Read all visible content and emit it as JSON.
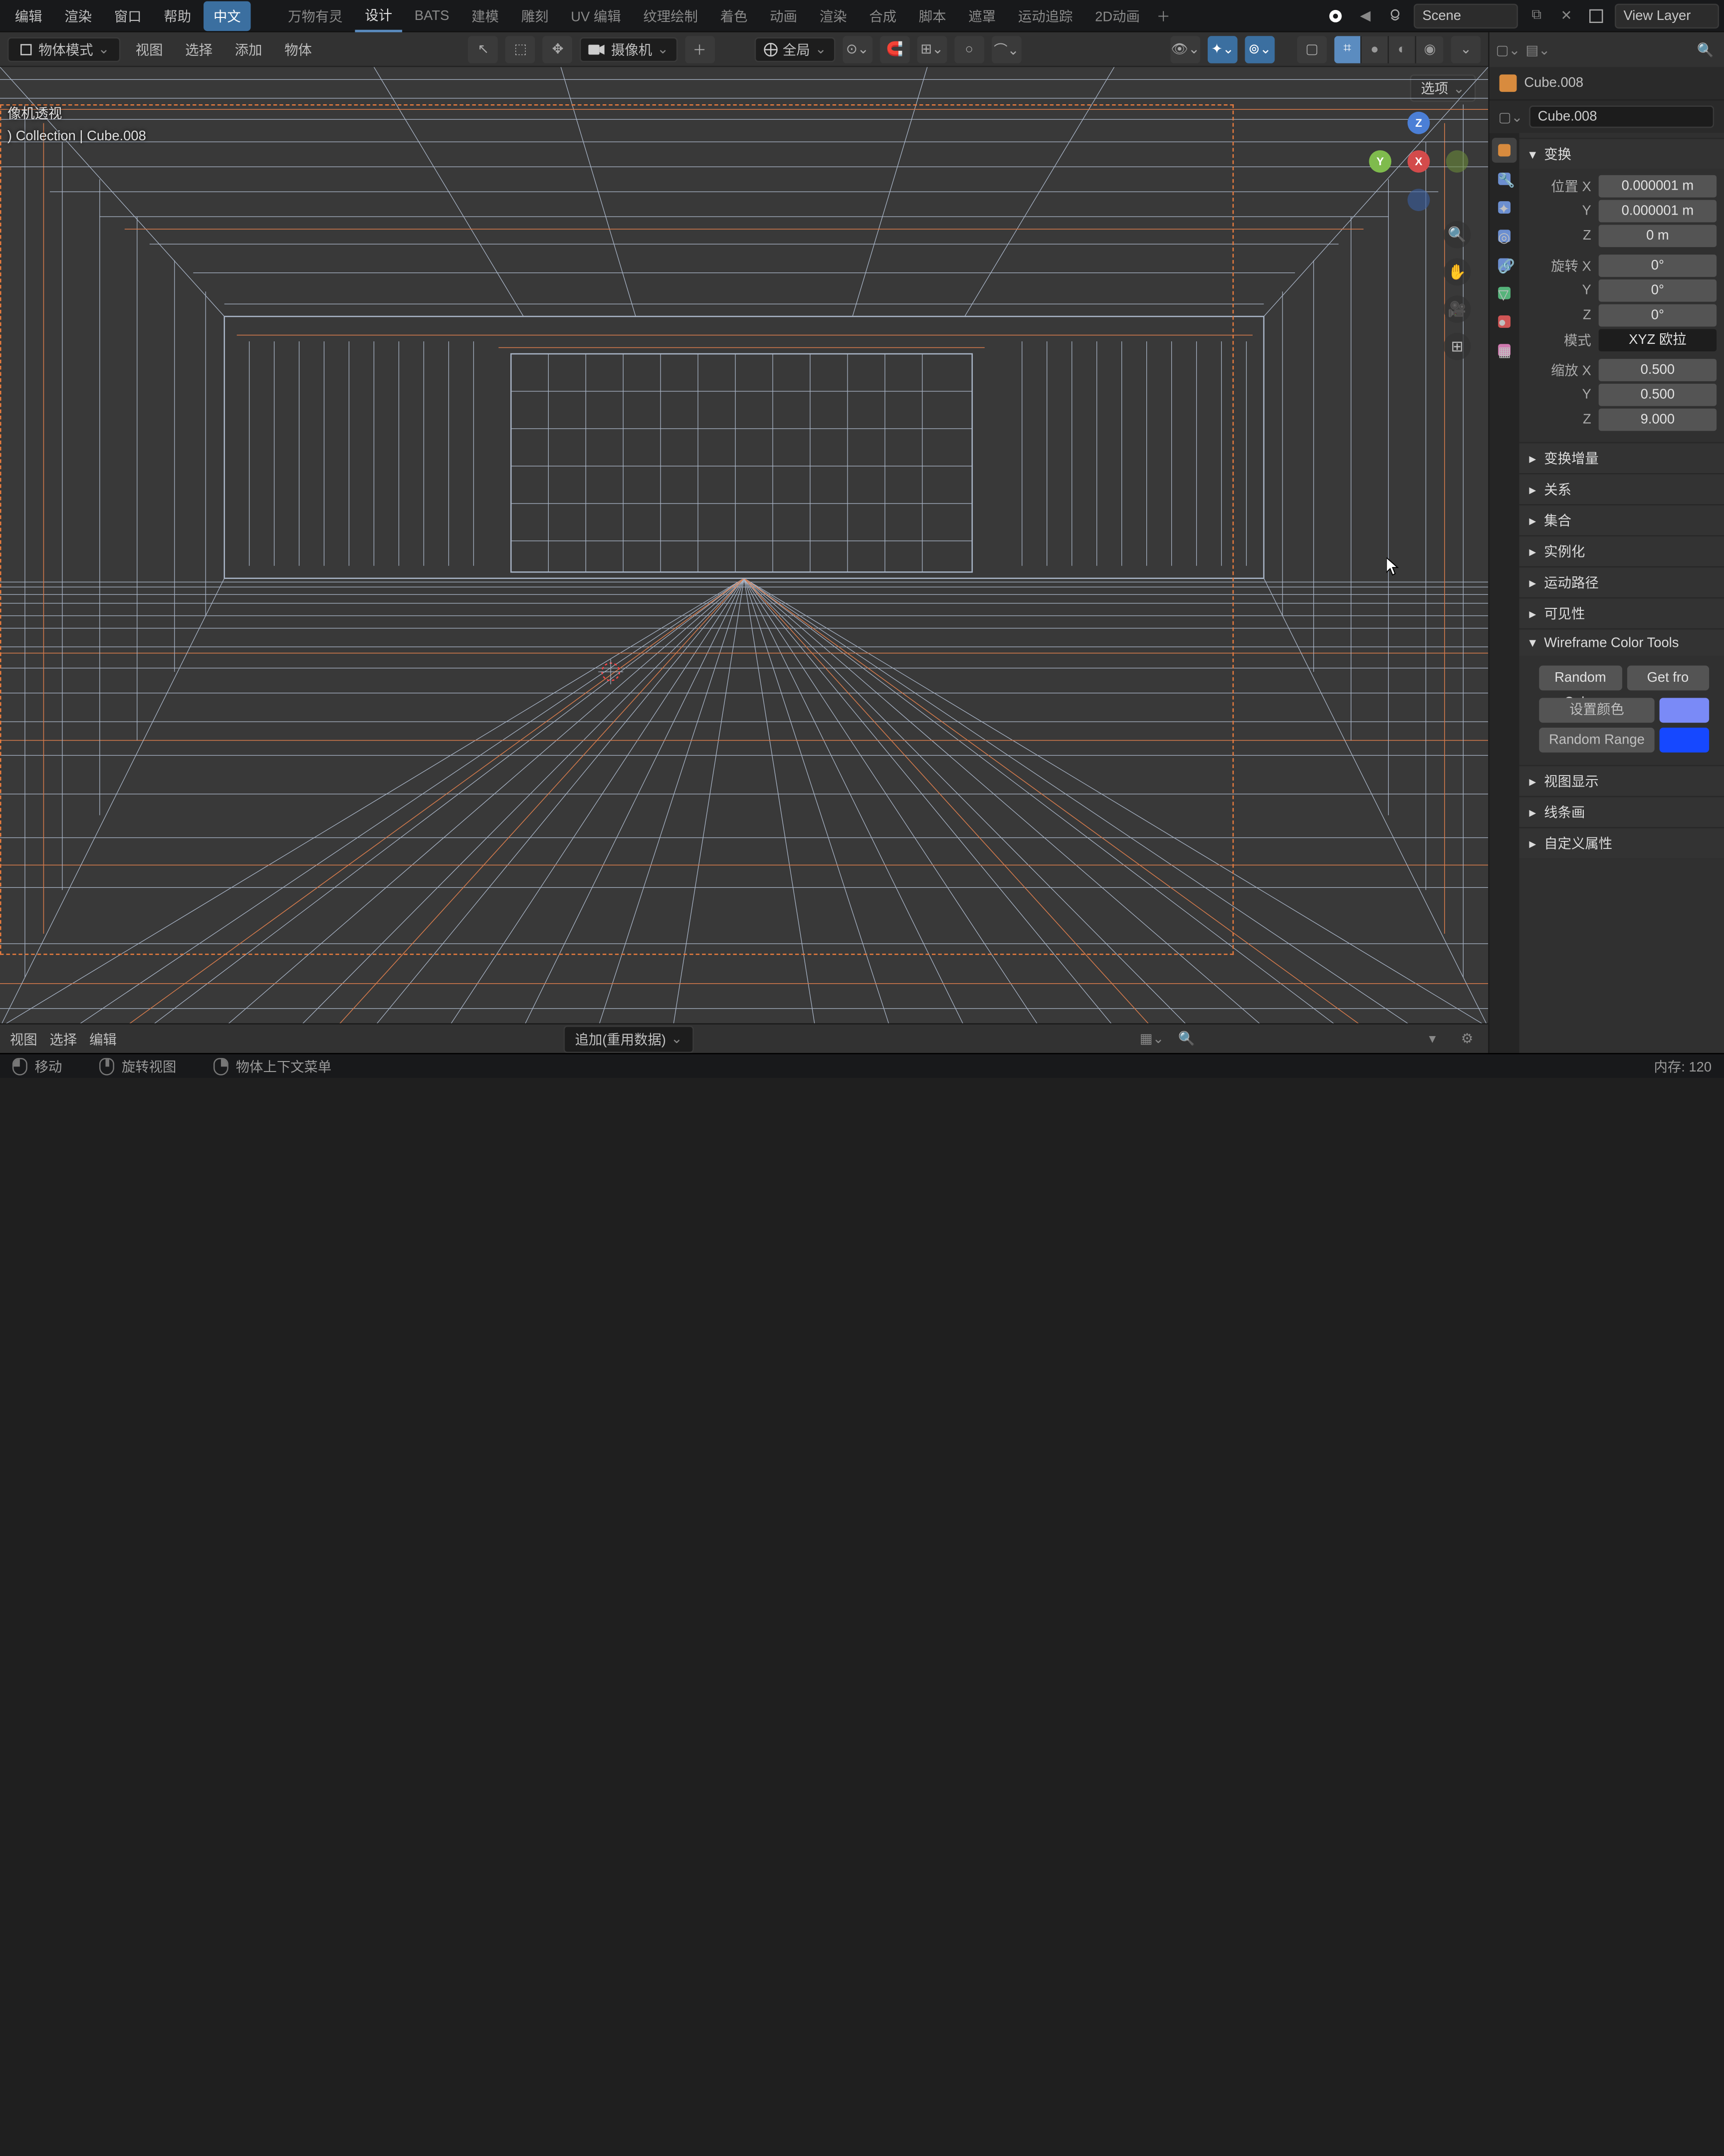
{
  "top_menu": {
    "items": [
      "编辑",
      "渲染",
      "窗口",
      "帮助"
    ],
    "lang": "中文",
    "workspaces": [
      "万物有灵",
      "设计",
      "BATS",
      "建模",
      "雕刻",
      "UV 编辑",
      "纹理绘制",
      "着色",
      "动画",
      "渲染",
      "合成",
      "脚本",
      "遮罩",
      "运动追踪",
      "2D动画"
    ],
    "active_ws": "设计",
    "scene_label": "Scene",
    "view_layer_label": "View Layer"
  },
  "view_toolbar": {
    "mode": "物体模式",
    "menus": [
      "视图",
      "选择",
      "添加",
      "物体"
    ],
    "camera_label": "摄像机",
    "pivot_label": "全局",
    "options_chip": "选项"
  },
  "viewport_overlay": {
    "line1": "像机透视",
    "line2": ") Collection | Cube.008"
  },
  "outliner": {
    "object": "Cube.008",
    "data": "Cube.008"
  },
  "transform": {
    "title": "变换",
    "location": {
      "label": "位置",
      "x": "0.000001 m",
      "y": "0.000001 m",
      "z": "0 m"
    },
    "rotation": {
      "label": "旋转",
      "x": "0°",
      "y": "0°",
      "z": "0°"
    },
    "mode_label": "模式",
    "mode_value": "XYZ 欧拉",
    "scale": {
      "label": "缩放",
      "x": "0.500",
      "y": "0.500",
      "z": "9.000"
    }
  },
  "panels": {
    "delta": "变换增量",
    "relations": "关系",
    "collection": "集合",
    "instancing": "实例化",
    "motion_path": "运动路径",
    "visibility": "可见性",
    "wireframe_tools": "Wireframe Color Tools",
    "viewport_display": "视图显示",
    "lineart": "线条画",
    "custom_props": "自定义属性"
  },
  "wireframe_tools": {
    "random_color": "Random Color",
    "get_from": "Get fro",
    "set_color": "设置颜色",
    "random_range": "Random Range",
    "swatch1": "#7a8af7",
    "swatch2": "#1648ff"
  },
  "bottom": {
    "menus": [
      "视图",
      "选择",
      "编辑"
    ],
    "add_reuse": "追加(重用数据)",
    "memory": "内存: 120"
  },
  "status": {
    "move": "移动",
    "rotate_view": "旋转视图",
    "context_menu": "物体上下文菜单"
  },
  "gizmo": {
    "x": "X",
    "y": "Y",
    "z": "Z"
  }
}
